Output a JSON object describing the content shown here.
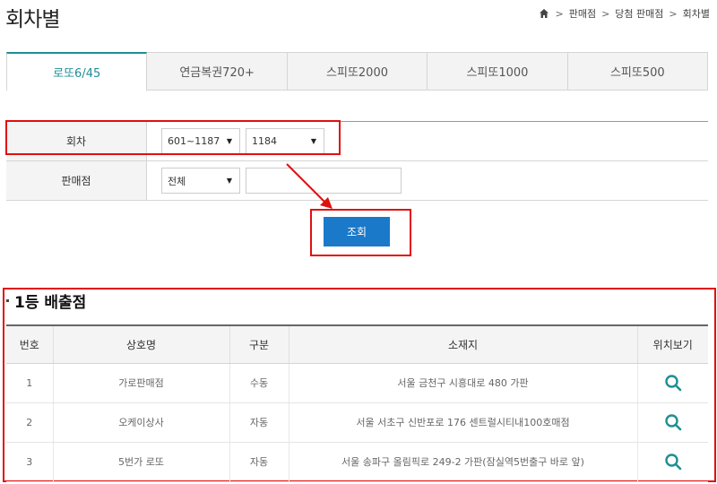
{
  "page": {
    "title": "회차별"
  },
  "breadcrumb": {
    "items": [
      "판매점",
      "당첨 판매점",
      "회차별"
    ]
  },
  "tabs": [
    {
      "label": "로또6/45",
      "active": true
    },
    {
      "label": "연금복권720+",
      "active": false
    },
    {
      "label": "스피또2000",
      "active": false
    },
    {
      "label": "스피또1000",
      "active": false
    },
    {
      "label": "스피또500",
      "active": false
    }
  ],
  "search": {
    "round_label": "회차",
    "round_range": "601~1187",
    "round_value": "1184",
    "store_label": "판매점",
    "store_value": "전체",
    "store_text": "",
    "button_label": "조회"
  },
  "results": {
    "title": "1등 배출점",
    "columns": [
      "번호",
      "상호명",
      "구분",
      "소재지",
      "위치보기"
    ],
    "rows": [
      {
        "no": "1",
        "name": "가로판매점",
        "type": "수동",
        "address": "서울 금천구 시흥대로 480 가판"
      },
      {
        "no": "2",
        "name": "오케이상사",
        "type": "자동",
        "address": "서울 서초구 신반포로 176 센트럴시티내100호매점"
      },
      {
        "no": "3",
        "name": "5번가 로또",
        "type": "자동",
        "address": "서울 송파구 올림픽로 249-2 가판(잠실역5번출구 바로 앞)"
      }
    ]
  },
  "colors": {
    "accent": "#1f8f94",
    "button": "#1a79c9",
    "highlight": "#e01010"
  }
}
